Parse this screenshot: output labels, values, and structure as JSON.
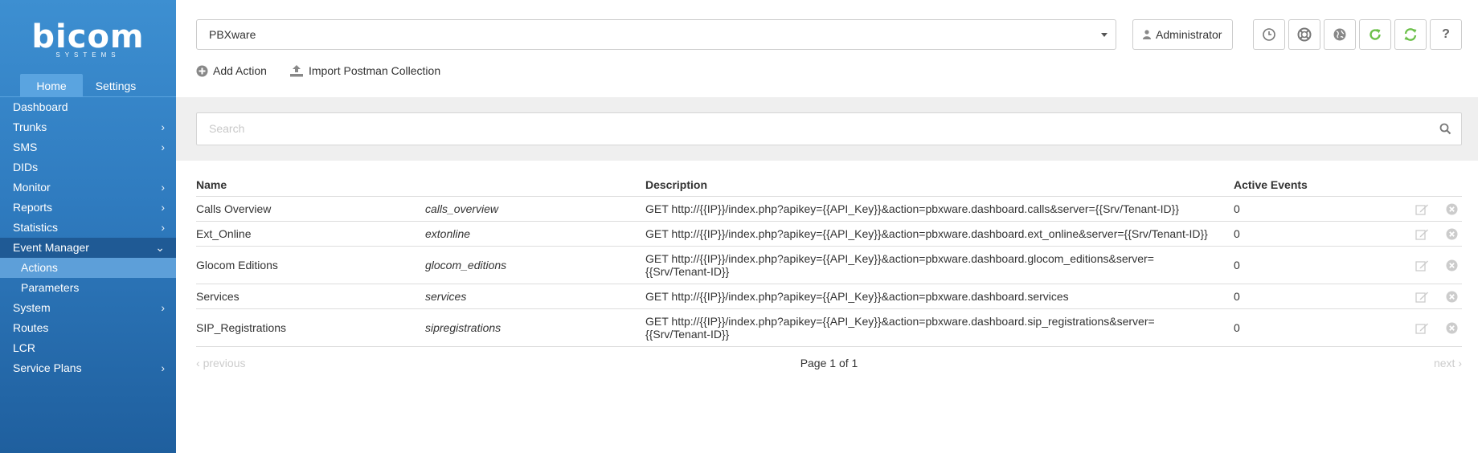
{
  "brand": {
    "logo": "bicom",
    "logo_sub": "SYSTEMS"
  },
  "sidebar": {
    "tabs": [
      {
        "label": "Home"
      },
      {
        "label": "Settings"
      }
    ],
    "items": [
      {
        "label": "Dashboard"
      },
      {
        "label": "Trunks"
      },
      {
        "label": "SMS"
      },
      {
        "label": "DIDs"
      },
      {
        "label": "Monitor"
      },
      {
        "label": "Reports"
      },
      {
        "label": "Statistics"
      },
      {
        "label": "Event Manager"
      },
      {
        "label": "Actions"
      },
      {
        "label": "Parameters"
      },
      {
        "label": "System"
      },
      {
        "label": "Routes"
      },
      {
        "label": "LCR"
      },
      {
        "label": "Service Plans"
      }
    ]
  },
  "header": {
    "server_select": "PBXware",
    "user": "Administrator",
    "icons": [
      "clock-icon",
      "lifebuoy-icon",
      "globe-icon",
      "refresh-icon",
      "sync-icon",
      "help-icon"
    ],
    "help_label": "?"
  },
  "toolbar": {
    "add_action": "Add Action",
    "import_postman": "Import Postman Collection"
  },
  "search": {
    "placeholder": "Search"
  },
  "table": {
    "headers": {
      "name": "Name",
      "id": "",
      "description": "Description",
      "active_events": "Active Events"
    },
    "rows": [
      {
        "name": "Calls Overview",
        "id": "calls_overview",
        "description": "GET http://{{IP}}/index.php?apikey={{API_Key}}&action=pbxware.dashboard.calls&server={{Srv/Tenant-ID}}",
        "active_events": "0"
      },
      {
        "name": "Ext_Online",
        "id": "extonline",
        "description": "GET http://{{IP}}/index.php?apikey={{API_Key}}&action=pbxware.dashboard.ext_online&server={{Srv/Tenant-ID}}",
        "active_events": "0"
      },
      {
        "name": "Glocom Editions",
        "id": "glocom_editions",
        "description": "GET http://{{IP}}/index.php?apikey={{API_Key}}&action=pbxware.dashboard.glocom_editions&server={{Srv/Tenant-ID}}",
        "active_events": "0"
      },
      {
        "name": "Services",
        "id": "services",
        "description": "GET http://{{IP}}/index.php?apikey={{API_Key}}&action=pbxware.dashboard.services",
        "active_events": "0"
      },
      {
        "name": "SIP_Registrations",
        "id": "sipregistrations",
        "description": "GET http://{{IP}}/index.php?apikey={{API_Key}}&action=pbxware.dashboard.sip_registrations&server={{Srv/Tenant-ID}}",
        "active_events": "0"
      }
    ]
  },
  "pagination": {
    "previous": "previous",
    "page_text": "Page 1 of 1",
    "next": "next"
  },
  "colors": {
    "sidebar_top": "#3d8fd1",
    "sidebar_bottom": "#1f5f9e",
    "active_item": "#5d9fd9",
    "open_item": "#1f5a95",
    "refresh_green": "#6cc04a"
  }
}
